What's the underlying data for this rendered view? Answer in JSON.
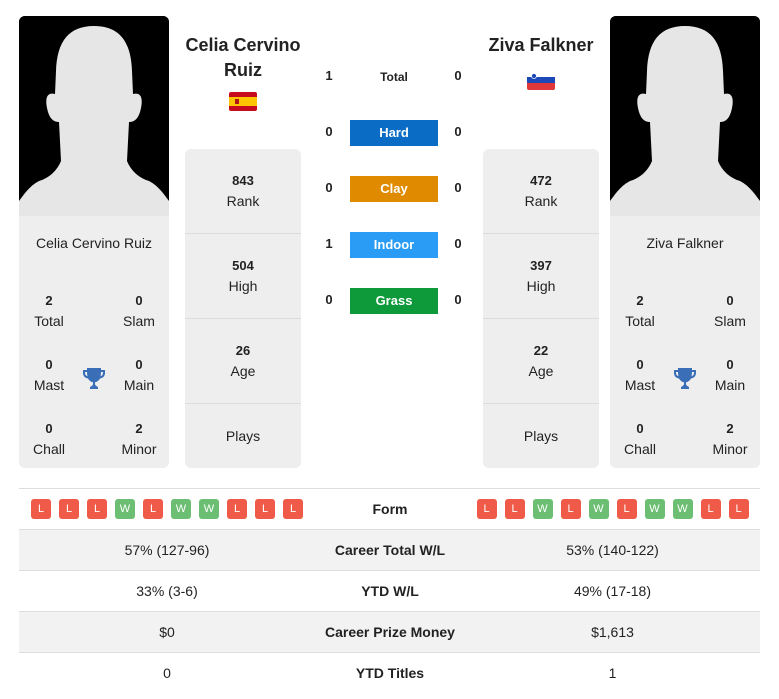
{
  "players": [
    {
      "name": "Celia Cervino Ruiz",
      "name_head_line1": "Celia Cervino",
      "name_head_line2": "Ruiz",
      "country_flag": "spain-flag",
      "rank": "843",
      "rank_label": "Rank",
      "high": "504",
      "high_label": "High",
      "age": "26",
      "age_label": "Age",
      "plays": "",
      "plays_label": "Plays",
      "titles": {
        "total": "2",
        "total_label": "Total",
        "slam": "0",
        "slam_label": "Slam",
        "mast": "0",
        "mast_label": "Mast",
        "main": "0",
        "main_label": "Main",
        "chall": "0",
        "chall_label": "Chall",
        "minor": "2",
        "minor_label": "Minor"
      },
      "form": [
        "L",
        "L",
        "L",
        "W",
        "L",
        "W",
        "W",
        "L",
        "L",
        "L"
      ]
    },
    {
      "name": "Ziva Falkner",
      "name_head_line1": "Ziva Falkner",
      "name_head_line2": "",
      "country_flag": "slovenia-flag",
      "rank": "472",
      "rank_label": "Rank",
      "high": "397",
      "high_label": "High",
      "age": "22",
      "age_label": "Age",
      "plays": "",
      "plays_label": "Plays",
      "titles": {
        "total": "2",
        "total_label": "Total",
        "slam": "0",
        "slam_label": "Slam",
        "mast": "0",
        "mast_label": "Mast",
        "main": "0",
        "main_label": "Main",
        "chall": "0",
        "chall_label": "Chall",
        "minor": "2",
        "minor_label": "Minor"
      },
      "form": [
        "L",
        "L",
        "W",
        "L",
        "W",
        "L",
        "W",
        "W",
        "L",
        "L"
      ]
    }
  ],
  "h2h": [
    {
      "label": "Total",
      "left": "1",
      "right": "0",
      "color": ""
    },
    {
      "label": "Hard",
      "left": "0",
      "right": "0",
      "color": "#0a6cc4"
    },
    {
      "label": "Clay",
      "left": "0",
      "right": "0",
      "color": "#e08a00"
    },
    {
      "label": "Indoor",
      "left": "1",
      "right": "0",
      "color": "#2a9cf5"
    },
    {
      "label": "Grass",
      "left": "0",
      "right": "0",
      "color": "#0e9a3a"
    }
  ],
  "stats": {
    "form_label": "Form",
    "rows": [
      {
        "label": "Career Total W/L",
        "left": "57% (127-96)",
        "right": "53% (140-122)"
      },
      {
        "label": "YTD W/L",
        "left": "33% (3-6)",
        "right": "49% (17-18)"
      },
      {
        "label": "Career Prize Money",
        "left": "$0",
        "right": "$1,613"
      },
      {
        "label": "YTD Titles",
        "left": "0",
        "right": "1"
      }
    ]
  },
  "colors": {
    "loss": "#f05a48",
    "win": "#6cbf72",
    "trophy": "#3a6fb8"
  }
}
